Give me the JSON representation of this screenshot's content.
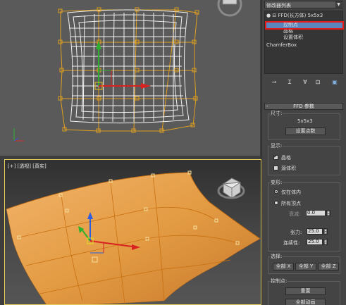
{
  "persp_viewport": {
    "label": "[+] [透视] [真实]"
  },
  "command_panel": {
    "modifier_list": {
      "value": "修改器列表"
    },
    "stack": {
      "items": [
        {
          "label": "FFD(长方体) 5x5x3"
        },
        {
          "label": "控制点",
          "selected": true
        },
        {
          "label": "晶格"
        },
        {
          "label": "设置体积"
        },
        {
          "label": "ChamferBox"
        }
      ]
    },
    "tools": [
      "pin-stack-icon",
      "show-end-result-icon",
      "make-unique-icon",
      "remove-modifier-icon",
      "configure-modifier-sets-icon"
    ],
    "ffd_params": {
      "title": "FFD 参数",
      "size_group": {
        "label": "尺寸:",
        "dims": "5x5x3",
        "set_points_button": "设置点数"
      },
      "display_group": {
        "label": "显示:",
        "lattice_label": "晶格",
        "lattice_checked": true,
        "source_volume_label": "源体积",
        "source_volume_checked": false
      },
      "deform_group": {
        "label": "变形:",
        "only_in_volume_label": "仅在体内",
        "all_vertices_label": "所有顶点",
        "falloff_label": "衰减:",
        "falloff_value": "0.0",
        "tension_label": "张力:",
        "tension_value": "25.0",
        "continuity_label": "连续性:",
        "continuity_value": "25.0"
      },
      "select_group": {
        "label": "选择:",
        "buttons": [
          "全部 X",
          "全部 Y",
          "全部 Z"
        ]
      },
      "control_points_group": {
        "label": "控制点:",
        "reset_button": "重置",
        "animate_all_button": "全部动画"
      }
    }
  }
}
